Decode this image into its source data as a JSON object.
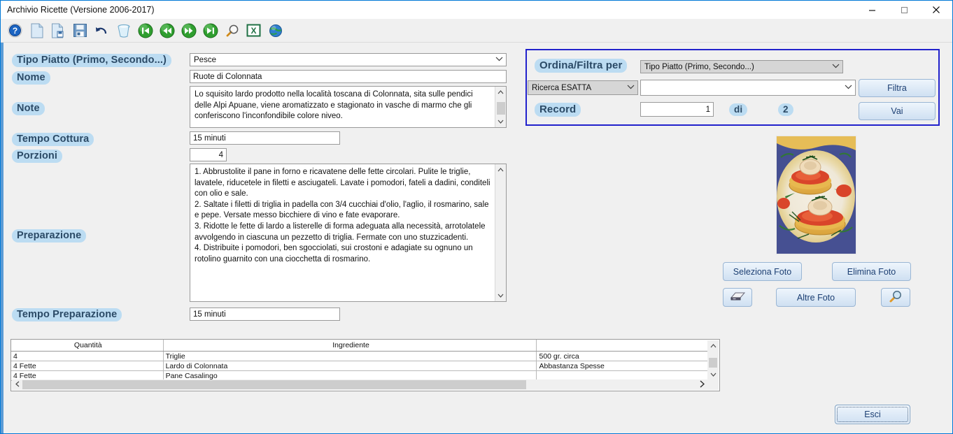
{
  "window": {
    "title": "Archivio Ricette (Versione 2006-2017)",
    "controls": {
      "minimize": "minimize-button",
      "maximize": "maximize-button",
      "close": "close-button"
    },
    "accent_border": "#0078d7",
    "background": "#f0f0f0",
    "left_strip_color": "#5b9bd5"
  },
  "toolbar": {
    "items": [
      {
        "name": "help-icon",
        "tip": "Guida"
      },
      {
        "name": "new-document-icon",
        "tip": "Nuovo"
      },
      {
        "name": "save-as-icon",
        "tip": "Salva con nome"
      },
      {
        "name": "save-icon",
        "tip": "Salva"
      },
      {
        "name": "undo-icon",
        "tip": "Annulla"
      },
      {
        "name": "delete-trash-icon",
        "tip": "Elimina"
      },
      {
        "name": "first-record-icon",
        "tip": "Primo"
      },
      {
        "name": "previous-record-icon",
        "tip": "Precedente"
      },
      {
        "name": "next-record-icon",
        "tip": "Successivo"
      },
      {
        "name": "last-record-icon",
        "tip": "Ultimo"
      },
      {
        "name": "search-magnifier-icon",
        "tip": "Cerca"
      },
      {
        "name": "excel-export-icon",
        "tip": "Esporta Excel"
      },
      {
        "name": "web-globe-icon",
        "tip": "Web"
      }
    ]
  },
  "form": {
    "labels": {
      "tipo_piatto": "Tipo Piatto (Primo, Secondo...)",
      "nome": "Nome",
      "note": "Note",
      "tempo_cottura": "Tempo Cottura",
      "porzioni": "Porzioni",
      "preparazione": "Preparazione",
      "tempo_preparazione": "Tempo Preparazione"
    },
    "values": {
      "tipo_piatto": "Pesce",
      "nome": "Ruote di Colonnata",
      "note": "Lo squisito lardo prodotto nella località toscana di Colonnata, sita sulle pendici delle Alpi Apuane, viene aromatizzato e stagionato in vasche di marmo che gli conferiscono l'inconfondibile colore niveo.",
      "tempo_cottura": "15 minuti",
      "porzioni": "4",
      "preparazione": "1. Abbrustolite il pane in forno e ricavatene delle fette circolari. Pulite le triglie, lavatele, riducetele in filetti e asciugateli. Lavate i pomodori, fateli a dadini, conditeli con olio e sale.\n2. Saltate i filetti di triglia in padella con 3/4 cucchiai d'olio, l'aglio, il rosmarino, sale e pepe. Versate messo bicchiere di vino e fate evaporare.\n3. Ridotte le fette di lardo a listerelle di forma adeguata alla necessità, arrotolatele avvolgendo in ciascuna un pezzetto di triglia. Fermate con uno stuzzicadenti.\n4. Distribuite i pomodori, ben sgocciolati, sui crostoni e adagiate su ognuno un rotolino guarnito con una ciocchetta di rosmarino.",
      "tempo_preparazione": "15 minuti"
    },
    "placeholders": {
      "nome": "",
      "tempo_cottura": "",
      "porzioni": "",
      "tempo_preparazione": ""
    }
  },
  "filter_panel": {
    "title": "Ordina/Filtra per",
    "sort_field": "Tipo Piatto (Primo, Secondo...)",
    "search_mode": "Ricerca ESATTA",
    "search_value": "",
    "search_placeholder": "",
    "filter_button": "Filtra",
    "record_label": "Record",
    "record_current": "1",
    "record_of": "di",
    "record_total": "2",
    "go_button": "Vai",
    "border_color": "#2222cc"
  },
  "photo": {
    "alt": "recipe-photo",
    "select_button": "Seleziona Foto",
    "delete_button": "Elimina Foto",
    "scanner_button_icon": "scanner-icon",
    "more_photos_button": "Altre Foto",
    "zoom_button_icon": "magnifier-icon"
  },
  "ingredients_table": {
    "columns": [
      "Quantità",
      "Ingrediente",
      ""
    ],
    "rows": [
      [
        "4",
        "Triglie",
        "500 gr. circa"
      ],
      [
        "4 Fette",
        "Lardo di Colonnata",
        "Abbastanza Spesse"
      ],
      [
        "4 Fette",
        "Pane Casalingo",
        ""
      ]
    ]
  },
  "footer": {
    "exit_button": "Esci"
  }
}
